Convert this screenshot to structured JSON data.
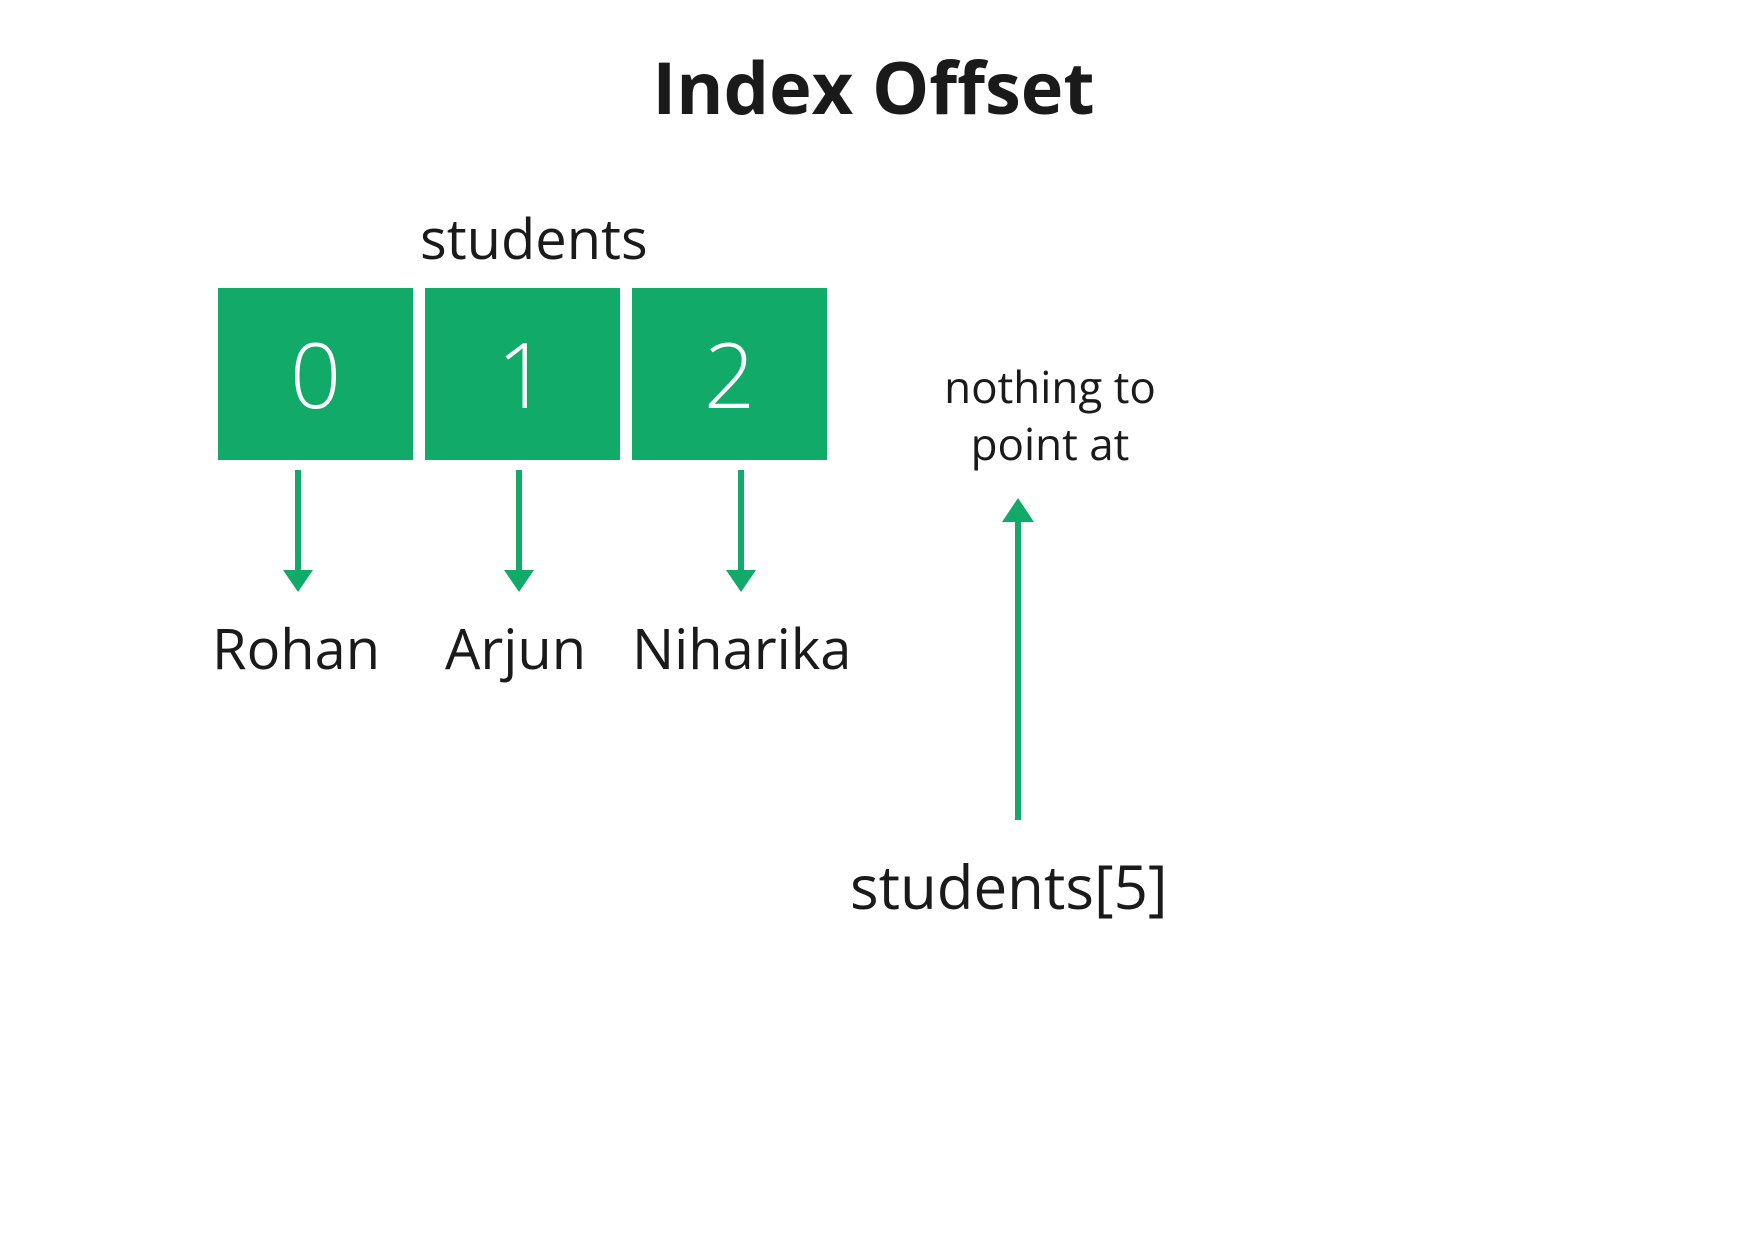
{
  "title": "Index Offset",
  "array_label": "students",
  "cells": {
    "0": "0",
    "1": "1",
    "2": "2"
  },
  "values": {
    "0": "Rohan",
    "1": "Arjun",
    "2": "Niharika"
  },
  "nothing_line1": "nothing to",
  "nothing_line2": "point at",
  "out_of_bounds": "students[5]",
  "colors": {
    "accent": "#12aa68",
    "text": "#1a1a1a"
  }
}
